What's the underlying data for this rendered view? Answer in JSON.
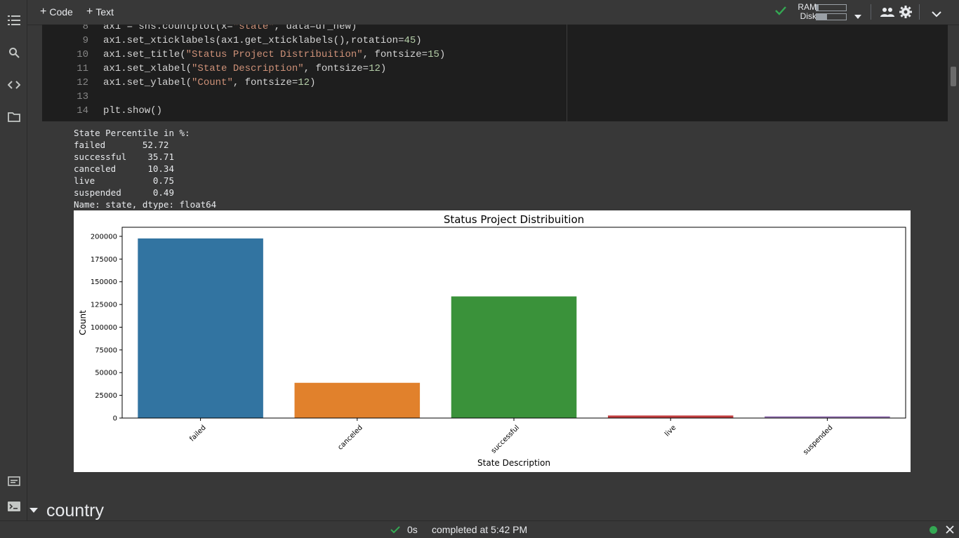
{
  "toolbar": {
    "code_label": "Code",
    "text_label": "Text",
    "ram_label": "RAM",
    "disk_label": "Disk",
    "ram_fraction": 0.08,
    "disk_fraction": 0.35
  },
  "code_lines": [
    {
      "num": "8",
      "html": "ax1 = sns.countplot(x=<span class='s'>\"state\"</span>, data=df_new)"
    },
    {
      "num": "9",
      "html": "ax1.set_xticklabels(ax1.get_xticklabels(),rotation=<span class='n'>45</span>)"
    },
    {
      "num": "10",
      "html": "ax1.set_title(<span class='s'>\"Status Project Distribuition\"</span>, fontsize=<span class='n'>15</span>)"
    },
    {
      "num": "11",
      "html": "ax1.set_xlabel(<span class='s'>\"State Description\"</span>, fontsize=<span class='n'>12</span>)"
    },
    {
      "num": "12",
      "html": "ax1.set_ylabel(<span class='s'>\"Count\"</span>, fontsize=<span class='n'>12</span>)"
    },
    {
      "num": "13",
      "html": ""
    },
    {
      "num": "14",
      "html": "plt.show()"
    }
  ],
  "output_text": "State Percentile in %:\nfailed       52.72\nsuccessful    35.71\ncanceled      10.34\nlive           0.75\nsuspended      0.49\nName: state, dtype: float64",
  "chart_data": {
    "type": "bar",
    "title": "Status Project Distribuition",
    "xlabel": "State Description",
    "ylabel": "Count",
    "categories": [
      "failed",
      "canceled",
      "successful",
      "live",
      "suspended"
    ],
    "values": [
      197700,
      38800,
      133900,
      2800,
      1850
    ],
    "colors": [
      "#3274a1",
      "#e1812c",
      "#3a923a",
      "#c03d3e",
      "#9372b2"
    ],
    "ylim": [
      0,
      210000
    ],
    "yticks": [
      0,
      25000,
      50000,
      75000,
      100000,
      125000,
      150000,
      175000,
      200000
    ],
    "ytick_labels": [
      "0",
      "25000",
      "50000",
      "75000",
      "100000",
      "125000",
      "150000",
      "175000",
      "200000"
    ]
  },
  "section": {
    "title": "country"
  },
  "status": {
    "elapsed": "0s",
    "completed": "completed at 5:42 PM"
  }
}
